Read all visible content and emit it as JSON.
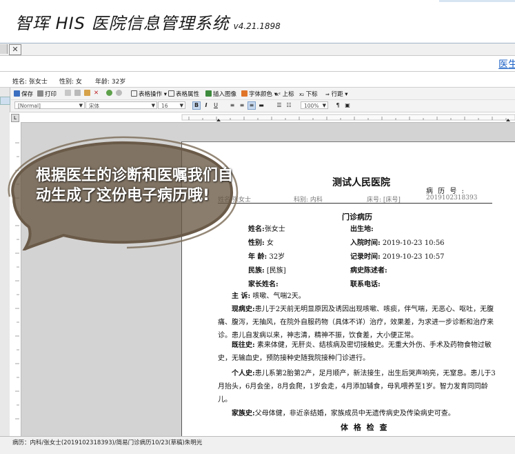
{
  "header": {
    "title": "智珲 HIS 医院信息管理系统",
    "version": "v4.21.1898"
  },
  "window": {
    "close_glyph": "✕",
    "doctor_link": "医生"
  },
  "patient_bar": {
    "name": "姓名: 张女士",
    "gender": "性别: 女",
    "age": "年龄: 32岁"
  },
  "toolbar1": {
    "save": "保存",
    "print": "打印",
    "table_ops": "表格操作",
    "table_props": "表格属性",
    "insert_image": "插入图像",
    "font_color": "字体颜色",
    "superscript": "上标",
    "subscript": "下标",
    "line_spacing": "行距"
  },
  "toolbar2": {
    "style": "[Normal]",
    "font": "宋体",
    "size": "16",
    "zoom": "100%",
    "bold": "B",
    "italic": "I",
    "underline": "U"
  },
  "document": {
    "hospital": "测试人民医院",
    "record_no_label": "病 历 号 :",
    "record_no": "2019102318393",
    "name_row": "姓名:张女士",
    "dept_row": "科别: 内科",
    "bed_row": "床号: [床号]",
    "section_title": "门诊病历",
    "fields": {
      "name_label": "姓名:",
      "name_value": "张女士",
      "gender_label": "性别:",
      "gender_value": "女",
      "age_label": "年 龄:",
      "age_value": "32岁",
      "ethnicity_label": "民族:",
      "ethnicity_value": "[民族]",
      "guardian_label": "家长姓名:",
      "birthplace_label": "出生地:",
      "admit_time_label": "入院时间:",
      "admit_time_value": "2019-10-23 10:56",
      "record_time_label": "记录时间:",
      "record_time_value": "2019-10-23 10:57",
      "narrator_label": "病史陈述者:",
      "phone_label": "联系电话:"
    },
    "chief_complaint_label": "主  诉:",
    "chief_complaint": "咳嗽、气喘2天。",
    "present_illness_label": "现病史:",
    "present_illness": "患儿于2天前无明显原因及诱因出现咳嗽、咳痰，伴气喘，无恶心、呕吐，无腹痛、腹泻，无抽风，在院外自服药物（具体不详）治疗，效果差，为求进一步诊断和治疗来诊。患儿自发病以来，神志清，精神不振，饮食差，大小便正常。",
    "past_history_label": "既往史:",
    "past_history": "素来体健，无肝炎、结核病及密切接触史。无重大外伤、手术及药物食物过敏史，无输血史，预防接种史随我院接种门诊进行。",
    "personal_history_label": "个人史:",
    "personal_history": "患儿系第2胎第2产，足月顺产，新法接生，出生后哭声响亮，无窒息。患儿于3月抬头，6月会坐，8月会爬，1岁会走，4月添加辅食，母乳喂养至1岁。智力发育同同龄儿。",
    "family_history_label": "家族史:",
    "family_history": "父母体健，非近亲结婚，家族成员中无遗传病史及传染病史可查。",
    "exam_title": "体 格 检 查"
  },
  "bubble": {
    "text": "根据医生的诊断和医嘱我们自动生成了这份电子病历哦!"
  },
  "status_bar": {
    "text": "病历：内科/张女士(2019102318393)/简易门诊病历10/23(草稿)朱明光"
  }
}
